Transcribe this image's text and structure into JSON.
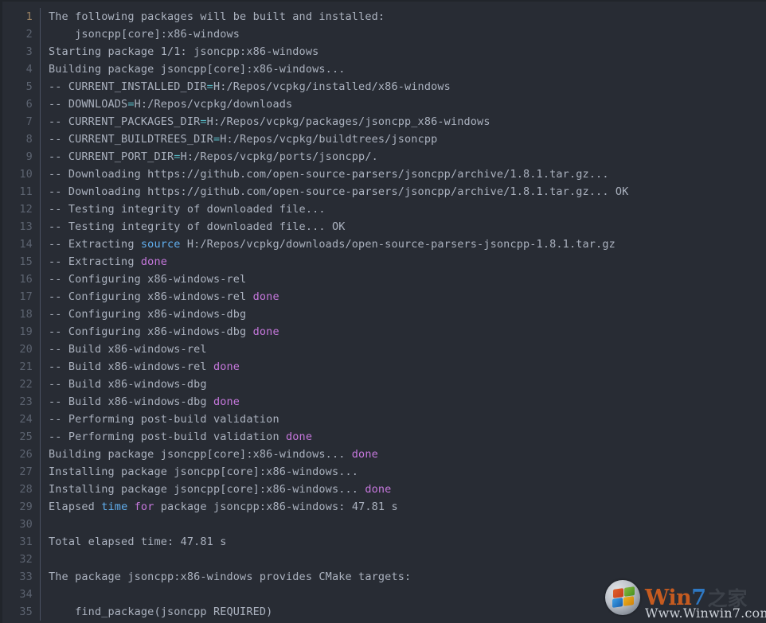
{
  "window": {
    "title": "vcpkg build output",
    "theme": "one-dark",
    "background_color": "#282c34",
    "gutter_divider_color": "#4b5263",
    "default_text_color": "#abb2bf",
    "line_number_color": "#5c6370",
    "cursor_line_number_color": "#9a8263"
  },
  "colors": {
    "operator": "#56b6c2",
    "keyword": "#c678dd",
    "type": "#61afef",
    "comment": "#7f848e",
    "default": "#abb2bf"
  },
  "editor": {
    "cursor_line": 1,
    "total_lines": 35,
    "lines": [
      {
        "n": 1,
        "tokens": [
          {
            "t": "The following packages will be built and installed:",
            "c": "default"
          }
        ]
      },
      {
        "n": 2,
        "tokens": [
          {
            "t": "    jsoncpp[core]:x86-windows",
            "c": "default"
          }
        ]
      },
      {
        "n": 3,
        "tokens": [
          {
            "t": "Starting package 1/1: jsoncpp:x86-windows",
            "c": "default"
          }
        ]
      },
      {
        "n": 4,
        "tokens": [
          {
            "t": "Building package jsoncpp[core]:x86-windows...",
            "c": "default"
          }
        ]
      },
      {
        "n": 5,
        "tokens": [
          {
            "t": "-- CURRENT_INSTALLED_DIR",
            "c": "default"
          },
          {
            "t": "=",
            "c": "operator"
          },
          {
            "t": "H:/Repos/vcpkg/installed/x86-windows",
            "c": "default"
          }
        ]
      },
      {
        "n": 6,
        "tokens": [
          {
            "t": "-- DOWNLOADS",
            "c": "default"
          },
          {
            "t": "=",
            "c": "operator"
          },
          {
            "t": "H:/Repos/vcpkg/downloads",
            "c": "default"
          }
        ]
      },
      {
        "n": 7,
        "tokens": [
          {
            "t": "-- CURRENT_PACKAGES_DIR",
            "c": "default"
          },
          {
            "t": "=",
            "c": "operator"
          },
          {
            "t": "H:/Repos/vcpkg/packages/jsoncpp_x86-windows",
            "c": "default"
          }
        ]
      },
      {
        "n": 8,
        "tokens": [
          {
            "t": "-- CURRENT_BUILDTREES_DIR",
            "c": "default"
          },
          {
            "t": "=",
            "c": "operator"
          },
          {
            "t": "H:/Repos/vcpkg/buildtrees/jsoncpp",
            "c": "default"
          }
        ]
      },
      {
        "n": 9,
        "tokens": [
          {
            "t": "-- CURRENT_PORT_DIR",
            "c": "default"
          },
          {
            "t": "=",
            "c": "operator"
          },
          {
            "t": "H:/Repos/vcpkg/ports/jsoncpp/.",
            "c": "default"
          }
        ]
      },
      {
        "n": 10,
        "tokens": [
          {
            "t": "-- Downloading https://github.com/open-source-parsers/jsoncpp/archive/1.8.1.tar.gz...",
            "c": "default"
          }
        ]
      },
      {
        "n": 11,
        "tokens": [
          {
            "t": "-- Downloading https://github.com/open-source-parsers/jsoncpp/archive/1.8.1.tar.gz... OK",
            "c": "default"
          }
        ]
      },
      {
        "n": 12,
        "tokens": [
          {
            "t": "-- Testing integrity of downloaded file...",
            "c": "default"
          }
        ]
      },
      {
        "n": 13,
        "tokens": [
          {
            "t": "-- Testing integrity of downloaded file... OK",
            "c": "default"
          }
        ]
      },
      {
        "n": 14,
        "tokens": [
          {
            "t": "-- Extracting ",
            "c": "default"
          },
          {
            "t": "source",
            "c": "type"
          },
          {
            "t": " H:/Repos/vcpkg/downloads/open-source-parsers-jsoncpp-1.8.1.tar.gz",
            "c": "default"
          }
        ]
      },
      {
        "n": 15,
        "tokens": [
          {
            "t": "-- Extracting ",
            "c": "default"
          },
          {
            "t": "done",
            "c": "keyword"
          }
        ]
      },
      {
        "n": 16,
        "tokens": [
          {
            "t": "-- Configuring x86-windows-rel",
            "c": "default"
          }
        ]
      },
      {
        "n": 17,
        "tokens": [
          {
            "t": "-- Configuring x86-windows-rel ",
            "c": "default"
          },
          {
            "t": "done",
            "c": "keyword"
          }
        ]
      },
      {
        "n": 18,
        "tokens": [
          {
            "t": "-- Configuring x86-windows-dbg",
            "c": "default"
          }
        ]
      },
      {
        "n": 19,
        "tokens": [
          {
            "t": "-- Configuring x86-windows-dbg ",
            "c": "default"
          },
          {
            "t": "done",
            "c": "keyword"
          }
        ]
      },
      {
        "n": 20,
        "tokens": [
          {
            "t": "-- Build x86-windows-rel",
            "c": "default"
          }
        ]
      },
      {
        "n": 21,
        "tokens": [
          {
            "t": "-- Build x86-windows-rel ",
            "c": "default"
          },
          {
            "t": "done",
            "c": "keyword"
          }
        ]
      },
      {
        "n": 22,
        "tokens": [
          {
            "t": "-- Build x86-windows-dbg",
            "c": "default"
          }
        ]
      },
      {
        "n": 23,
        "tokens": [
          {
            "t": "-- Build x86-windows-dbg ",
            "c": "default"
          },
          {
            "t": "done",
            "c": "keyword"
          }
        ]
      },
      {
        "n": 24,
        "tokens": [
          {
            "t": "-- Performing post-build validation",
            "c": "default"
          }
        ]
      },
      {
        "n": 25,
        "tokens": [
          {
            "t": "-- Performing post-build validation ",
            "c": "default"
          },
          {
            "t": "done",
            "c": "keyword"
          }
        ]
      },
      {
        "n": 26,
        "tokens": [
          {
            "t": "Building package jsoncpp[core]:x86-windows... ",
            "c": "default"
          },
          {
            "t": "done",
            "c": "keyword"
          }
        ]
      },
      {
        "n": 27,
        "tokens": [
          {
            "t": "Installing package jsoncpp[core]:x86-windows...",
            "c": "default"
          }
        ]
      },
      {
        "n": 28,
        "tokens": [
          {
            "t": "Installing package jsoncpp[core]:x86-windows... ",
            "c": "default"
          },
          {
            "t": "done",
            "c": "keyword"
          }
        ]
      },
      {
        "n": 29,
        "tokens": [
          {
            "t": "Elapsed ",
            "c": "default"
          },
          {
            "t": "time",
            "c": "type"
          },
          {
            "t": " ",
            "c": "default"
          },
          {
            "t": "for",
            "c": "keyword"
          },
          {
            "t": " package jsoncpp:x86-windows: 47.81 s",
            "c": "default"
          }
        ]
      },
      {
        "n": 30,
        "tokens": []
      },
      {
        "n": 31,
        "tokens": [
          {
            "t": "Total elapsed time: 47.81 s",
            "c": "default"
          }
        ]
      },
      {
        "n": 32,
        "tokens": []
      },
      {
        "n": 33,
        "tokens": [
          {
            "t": "The package jsoncpp:x86-windows provides CMake targets:",
            "c": "default"
          }
        ]
      },
      {
        "n": 34,
        "tokens": []
      },
      {
        "n": 35,
        "tokens": [
          {
            "t": "    find_package(jsoncpp REQUIRED)",
            "c": "default"
          }
        ]
      }
    ]
  },
  "watermark": {
    "brand_win": "Win",
    "brand_seven": "7",
    "brand_suffix": "之家",
    "url": "Www.Winwin7.com",
    "logo_name": "windows-orb-logo",
    "brand_color_win": "#d4601f",
    "brand_color_seven": "#2f7fd0"
  }
}
